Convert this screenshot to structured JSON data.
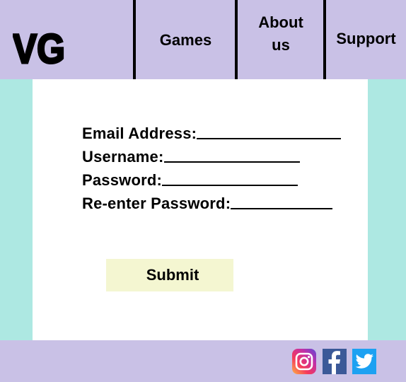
{
  "header": {
    "logo_text": "VG",
    "nav": [
      {
        "label": "Games"
      },
      {
        "label": "About us"
      },
      {
        "label": "Support"
      }
    ]
  },
  "form": {
    "email_label": "Email Address:",
    "username_label": "Username:",
    "password_label": "Password:",
    "reenter_label": "Re-enter Password:",
    "email_value": "",
    "username_value": "",
    "password_value": "",
    "reenter_value": "",
    "submit_label": "Submit"
  },
  "footer": {
    "social": [
      {
        "icon": "instagram-icon"
      },
      {
        "icon": "facebook-icon"
      },
      {
        "icon": "twitter-icon"
      }
    ]
  },
  "colors": {
    "header_bg": "#c9c1e6",
    "page_bg": "#ade8e2",
    "submit_bg": "#f4f6d1",
    "facebook": "#3b5998",
    "twitter": "#1da1f2"
  }
}
